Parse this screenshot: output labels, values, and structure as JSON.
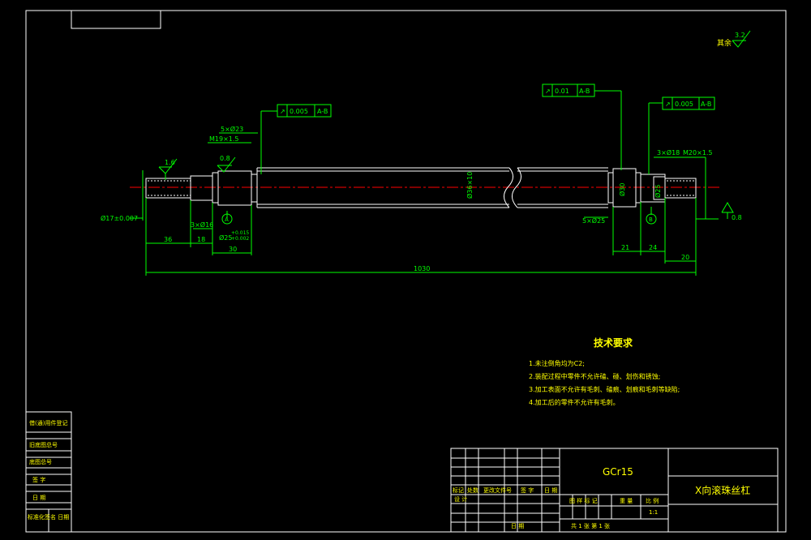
{
  "roughness_note": {
    "label": "其余",
    "value": "3.2"
  },
  "tolerance_frames": [
    {
      "symbol": "↗",
      "value": "0.005",
      "datum": "A-B"
    },
    {
      "symbol": "↗",
      "value": "0.01",
      "datum": "A-B"
    },
    {
      "symbol": "↗",
      "value": "0.005",
      "datum": "A-B"
    }
  ],
  "dimensions": {
    "left_chamfer": "5×Ø23",
    "left_thread": "M19×1.5",
    "left_rough": "1.6",
    "left_rough2": "0.8",
    "left_dia": "Ø17±0.007",
    "groove_left": "3×Ø16",
    "bearing_dia": "Ø25",
    "bearing_tol_upper": "+0.015",
    "bearing_tol_lower": "+0.002",
    "len_36": "36",
    "len_18": "18",
    "len_30": "30",
    "main_dia": "Ø36×10",
    "total_len": "1030",
    "right_dia": "Ø30",
    "right_small": "5×Ø25",
    "right_groove": "3×Ø18",
    "right_thread": "M20×1.5",
    "right_rough": "0.8",
    "len_21": "21",
    "len_24": "24",
    "len_20": "20",
    "right_inner_dia": "Ø25",
    "datum_a": "A",
    "datum_b": "B"
  },
  "tech_requirements": {
    "title": "技术要求",
    "items": [
      "1.未注倒角均为C2;",
      "2.装配过程中零件不允许磕、碰、划伤和锈蚀;",
      "3.加工表面不允许有毛刺、磕痕、划痕和毛刺等缺陷;",
      "4.加工后的零件不允许有毛刺。"
    ]
  },
  "side_table": {
    "rows": [
      "借(通)用件登记",
      "旧底图总号",
      "底图总号",
      "签 字",
      "日 期",
      "标准化签名 日期"
    ]
  },
  "title_block": {
    "material": "GCr15",
    "part_name": "X向滚珠丝杠",
    "rev_headers": [
      "标记",
      "处数",
      "更改文件号",
      "签 字",
      "日 期"
    ],
    "design_label": "设 计",
    "stage_labels": [
      "图 样 标 记",
      "重 量",
      "比 例"
    ],
    "scale": "1:1",
    "sheet_info": "共 1 张    第 1 张",
    "date_label": "日 期"
  },
  "colors": {
    "background": "#000000",
    "frame": "#ffffff",
    "dimension": "#00ff00",
    "centerline": "#ff0000",
    "text_yellow": "#ffff00"
  }
}
